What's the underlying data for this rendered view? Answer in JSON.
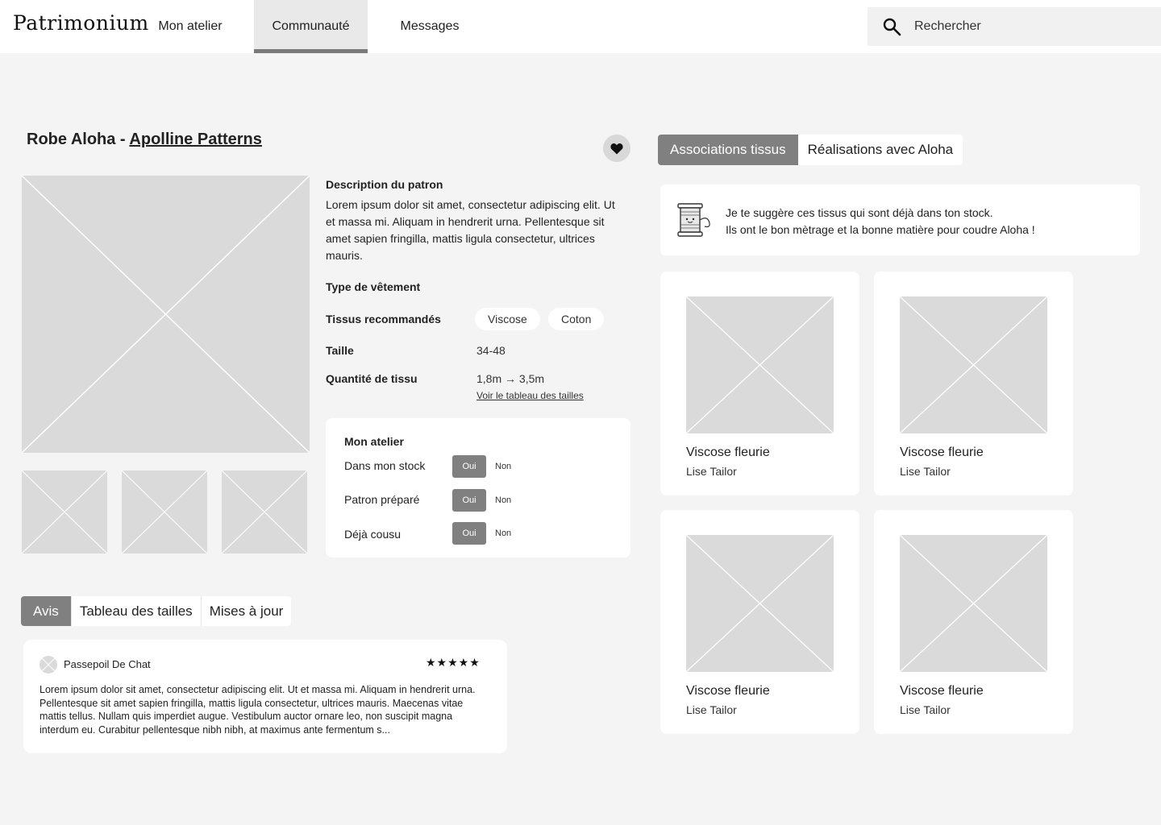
{
  "header": {
    "logo": "Patrimonium",
    "nav": [
      {
        "label": "Mon atelier"
      },
      {
        "label": "Communauté"
      },
      {
        "label": "Messages"
      }
    ],
    "search_placeholder": "Rechercher"
  },
  "pattern": {
    "title_prefix": "Robe Aloha - ",
    "designer": "Apolline Patterns",
    "description_title": "Description du patron",
    "description": "Lorem ipsum dolor sit amet, consectetur adipiscing elit. Ut et massa mi. Aliquam in hendrerit urna. Pellentesque sit amet sapien fringilla, mattis ligula consectetur, ultrices mauris.",
    "garment_type_label": "Type de vêtement",
    "fabrics_label": "Tissus recommandés",
    "fabrics": [
      "Viscose",
      "Coton"
    ],
    "size_label": "Taille",
    "size_value": "34-48",
    "quantity_label": "Quantité de tissu",
    "quantity_value": "1,8m → 3,5m",
    "size_chart_link": "Voir le tableau des tailles"
  },
  "atelier": {
    "title": "Mon atelier",
    "rows": [
      {
        "label": "Dans mon stock",
        "yes": "Oui",
        "no": "Non"
      },
      {
        "label": "Patron préparé",
        "yes": "Oui",
        "no": "Non"
      },
      {
        "label": "Déjà cousu",
        "yes": "Oui",
        "no": "Non"
      }
    ]
  },
  "bottom_tabs": [
    "Avis",
    "Tableau des tailles",
    "Mises à jour"
  ],
  "review": {
    "author": "Passepoil De Chat",
    "stars": "★★★★★",
    "text": "Lorem ipsum dolor sit amet, consectetur adipiscing elit. Ut et massa mi. Aliquam in hendrerit urna. Pellentesque sit amet sapien fringilla, mattis ligula consectetur, ultrices mauris. Maecenas vitae mattis tellus. Nullam quis imperdiet augue. Vestibulum auctor ornare leo, non suscipit magna interdum eu. Curabitur pellentesque nibh nibh, at maximus ante fermentum s..."
  },
  "right_tabs": [
    "Associations tissus",
    "Réalisations avec Aloha"
  ],
  "suggestion": {
    "line1": "Je te suggère ces tissus qui sont déjà dans ton stock.",
    "line2": "Ils ont le bon mètrage et la bonne matière pour coudre Aloha !"
  },
  "fabric_cards": [
    {
      "name": "Viscose fleurie",
      "brand": "Lise Tailor"
    },
    {
      "name": "Viscose fleurie",
      "brand": "Lise Tailor"
    },
    {
      "name": "Viscose fleurie",
      "brand": "Lise Tailor"
    },
    {
      "name": "Viscose fleurie",
      "brand": "Lise Tailor"
    }
  ],
  "colors": {
    "background": "#f4f4f4",
    "accent_gray": "#808080",
    "placeholder": "#dadada"
  }
}
